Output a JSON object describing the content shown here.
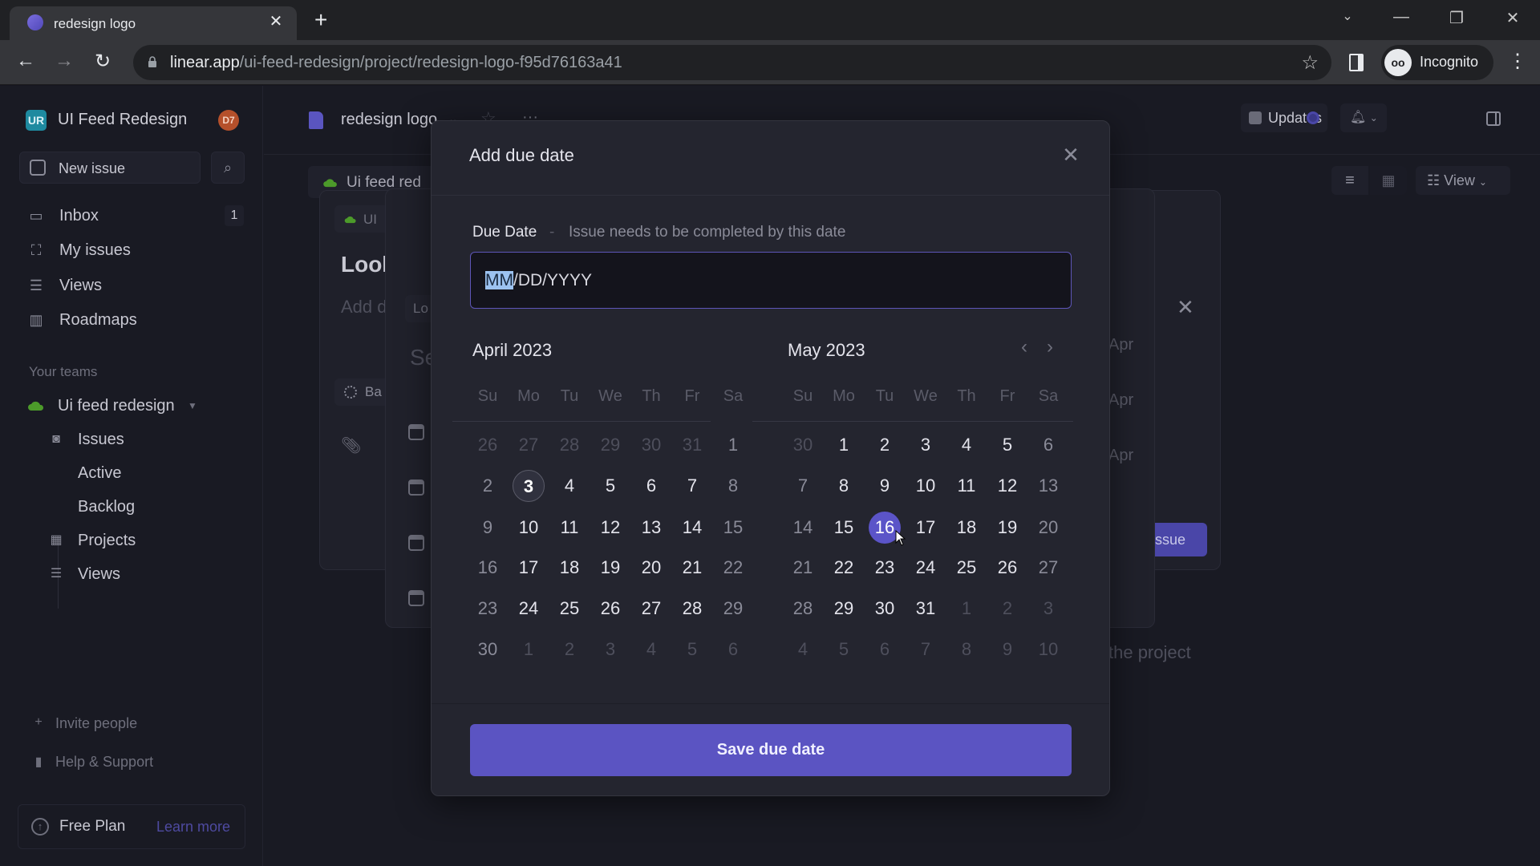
{
  "browser": {
    "tab_title": "redesign logo",
    "url_host": "linear.app",
    "url_path": "/ui-feed-redesign/project/redesign-logo-f95d76163a41",
    "profile_label": "Incognito"
  },
  "sidebar": {
    "workspace_initials": "UR",
    "workspace_name": "UI Feed Redesign",
    "user_initials": "D7",
    "new_issue_label": "New issue",
    "nav": [
      {
        "label": "Inbox",
        "badge": "1",
        "icon": "inbox-icon"
      },
      {
        "label": "My issues",
        "icon": "my-issues-icon"
      },
      {
        "label": "Views",
        "icon": "layers-icon"
      },
      {
        "label": "Roadmaps",
        "icon": "map-icon"
      }
    ],
    "teams_title": "Your teams",
    "team_name": "Ui feed redesign",
    "team_items": [
      {
        "label": "Issues",
        "icon": "issues-icon"
      },
      {
        "label": "Active"
      },
      {
        "label": "Backlog"
      },
      {
        "label": "Projects",
        "icon": "grid-icon"
      },
      {
        "label": "Views",
        "icon": "layers-icon"
      }
    ],
    "invite_label": "Invite people",
    "help_label": "Help & Support",
    "plan_label": "Free Plan",
    "plan_link": "Learn more"
  },
  "header": {
    "project_title": "redesign logo",
    "updates_label": "Updates",
    "view_label": "View"
  },
  "background": {
    "team_chip": "Ui feed red",
    "issue_chip": "UI",
    "issue_title": "Look",
    "issue_desc": "Add d",
    "status_label": "Ba",
    "sub_chip": "Lo",
    "sub_text": "Se",
    "apr_labels": [
      "Apr",
      "Apr",
      "Apr"
    ],
    "submit_label": "ssue",
    "project_hint": "the project"
  },
  "modal": {
    "title": "Add due date",
    "field_label": "Due Date",
    "field_separator": "-",
    "field_help": "Issue needs to be completed by this date",
    "input_highlight": "MM",
    "input_rest": "/DD/YYYY",
    "save_label": "Save due date",
    "weekdays": [
      "Su",
      "Mo",
      "Tu",
      "We",
      "Th",
      "Fr",
      "Sa"
    ],
    "months": [
      {
        "title": "April 2023",
        "weeks": [
          [
            "26",
            "27",
            "28",
            "29",
            "30",
            "31",
            "1"
          ],
          [
            "2",
            "3",
            "4",
            "5",
            "6",
            "7",
            "8"
          ],
          [
            "9",
            "10",
            "11",
            "12",
            "13",
            "14",
            "15"
          ],
          [
            "16",
            "17",
            "18",
            "19",
            "20",
            "21",
            "22"
          ],
          [
            "23",
            "24",
            "25",
            "26",
            "27",
            "28",
            "29"
          ],
          [
            "30",
            "1",
            "2",
            "3",
            "4",
            "5",
            "6"
          ]
        ],
        "other_month": [
          [
            0,
            0
          ],
          [
            0,
            1
          ],
          [
            0,
            2
          ],
          [
            0,
            3
          ],
          [
            0,
            4
          ],
          [
            0,
            5
          ],
          [
            5,
            1
          ],
          [
            5,
            2
          ],
          [
            5,
            3
          ],
          [
            5,
            4
          ],
          [
            5,
            5
          ],
          [
            5,
            6
          ]
        ],
        "today": [
          1,
          1
        ]
      },
      {
        "title": "May 2023",
        "weeks": [
          [
            "30",
            "1",
            "2",
            "3",
            "4",
            "5",
            "6"
          ],
          [
            "7",
            "8",
            "9",
            "10",
            "11",
            "12",
            "13"
          ],
          [
            "14",
            "15",
            "16",
            "17",
            "18",
            "19",
            "20"
          ],
          [
            "21",
            "22",
            "23",
            "24",
            "25",
            "26",
            "27"
          ],
          [
            "28",
            "29",
            "30",
            "31",
            "1",
            "2",
            "3"
          ],
          [
            "4",
            "5",
            "6",
            "7",
            "8",
            "9",
            "10"
          ]
        ],
        "other_month": [
          [
            0,
            0
          ],
          [
            4,
            4
          ],
          [
            4,
            5
          ],
          [
            4,
            6
          ],
          [
            5,
            0
          ],
          [
            5,
            1
          ],
          [
            5,
            2
          ],
          [
            5,
            3
          ],
          [
            5,
            4
          ],
          [
            5,
            5
          ],
          [
            5,
            6
          ]
        ],
        "selected": [
          2,
          2
        ]
      }
    ]
  },
  "colors": {
    "accent": "#5b54c2",
    "selected_day": "#5b54c8",
    "input_border": "#5e56b8",
    "team_green": "#4c9a2a",
    "workspace_teal": "#1e8aa0",
    "avatar_orange": "#b5502b"
  }
}
